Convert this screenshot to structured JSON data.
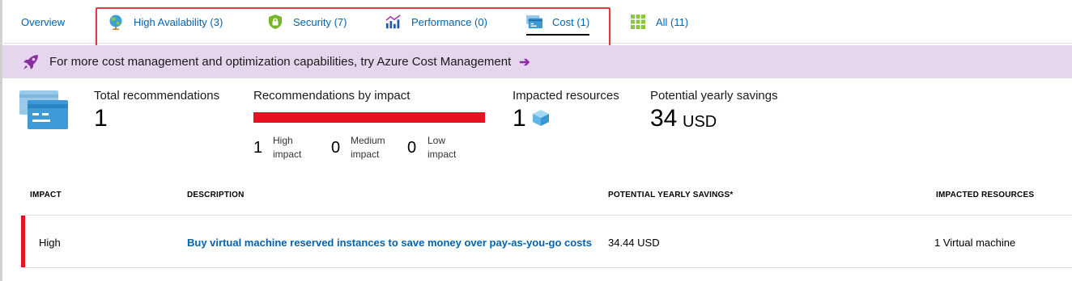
{
  "tabs": [
    {
      "label": "Overview",
      "icon": "none"
    },
    {
      "label": "High Availability (3)",
      "icon": "globe-icon"
    },
    {
      "label": "Security (7)",
      "icon": "shield-lock-icon"
    },
    {
      "label": "Performance (0)",
      "icon": "performance-chart-icon"
    },
    {
      "label": "Cost (1)",
      "icon": "cost-card-icon",
      "active": true
    },
    {
      "label": "All (11)",
      "icon": "grid-icon"
    }
  ],
  "banner": {
    "text": "For more cost management and optimization capabilities, try Azure Cost Management",
    "arrow": "➔"
  },
  "summary": {
    "total_label": "Total recommendations",
    "total_value": "1",
    "impact_label": "Recommendations by impact",
    "high_count": "1",
    "high_label_1": "High",
    "high_label_2": "impact",
    "medium_count": "0",
    "medium_label_1": "Medium",
    "medium_label_2": "impact",
    "low_count": "0",
    "low_label_1": "Low",
    "low_label_2": "impact",
    "resources_label": "Impacted resources",
    "resources_value": "1",
    "savings_label": "Potential yearly savings",
    "savings_value": "34",
    "savings_unit": "USD"
  },
  "table": {
    "headers": [
      "IMPACT",
      "DESCRIPTION",
      "POTENTIAL YEARLY SAVINGS*",
      "IMPACTED RESOURCES"
    ],
    "rows": [
      {
        "impact": "High",
        "description": "Buy virtual machine reserved instances to save money over pay-as-you-go costs",
        "savings": "34.44 USD",
        "resources": "1 Virtual machine"
      }
    ]
  },
  "colors": {
    "link": "#0063b1",
    "high_impact": "#e81123",
    "banner_bg": "#e5d6ee",
    "banner_accent": "#8a2da5"
  }
}
